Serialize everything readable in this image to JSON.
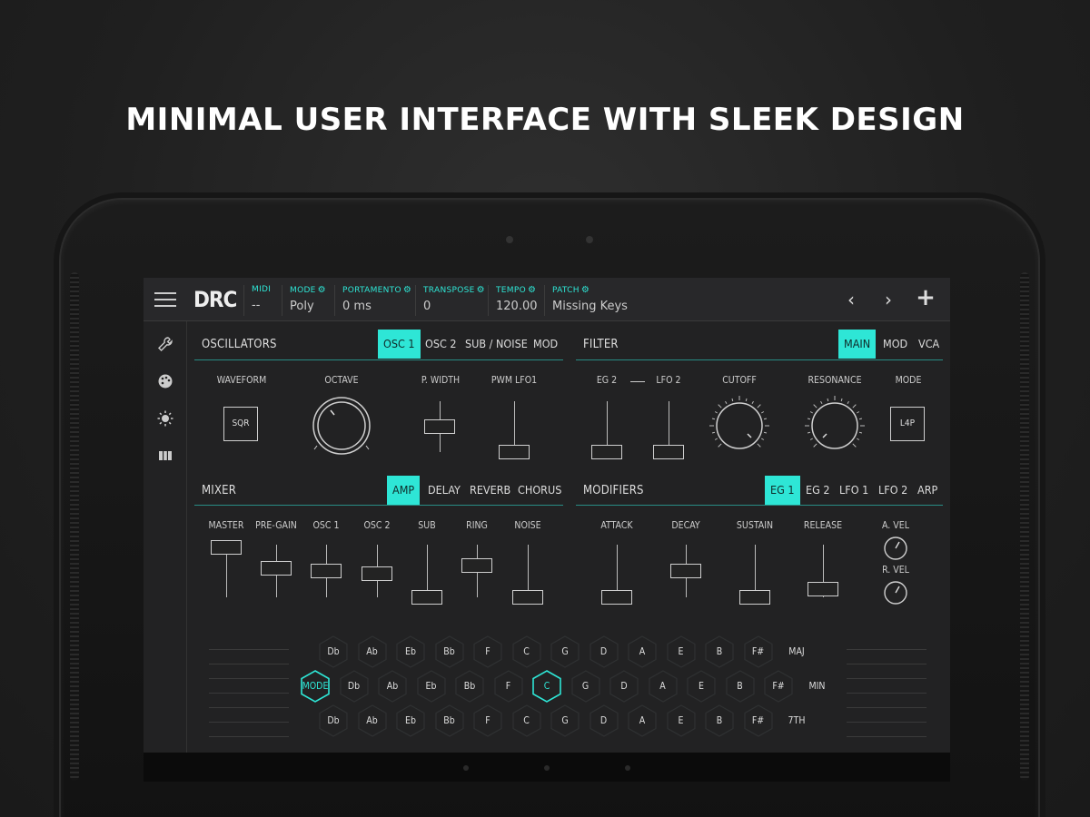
{
  "headline": "MINIMAL USER INTERFACE WITH SLEEK DESIGN",
  "accent_color": "#2ee6d6",
  "app": {
    "logo": "DRC",
    "fields": [
      {
        "label": "MIDI",
        "value": "--",
        "gear": false
      },
      {
        "label": "MODE",
        "value": "Poly",
        "gear": true
      },
      {
        "label": "PORTAMENTO",
        "value": "0 ms",
        "gear": true
      },
      {
        "label": "TRANSPOSE",
        "value": "0",
        "gear": true
      },
      {
        "label": "TEMPO",
        "value": "120.00",
        "gear": true
      },
      {
        "label": "PATCH",
        "value": "Missing Keys",
        "gear": true
      }
    ],
    "nav": {
      "prev": "‹",
      "next": "›",
      "add": "+"
    },
    "sidebar_icons": [
      "wrench-icon",
      "palette-icon",
      "brightness-icon",
      "film-icon"
    ]
  },
  "oscillators": {
    "title": "OSCILLATORS",
    "tabs": [
      "OSC 1",
      "OSC 2",
      "SUB / NOISE",
      "MOD"
    ],
    "active_tab": 0,
    "waveform_label": "WAVEFORM",
    "waveform_value": "SQR",
    "octave_label": "OCTAVE",
    "pwidth_label": "P. WIDTH",
    "pwm_label": "PWM LFO1"
  },
  "filter": {
    "title": "FILTER",
    "tabs": [
      "MAIN",
      "MOD",
      "VCA"
    ],
    "active_tab": 0,
    "eg2_label": "EG 2",
    "lfo2_label": "LFO 2",
    "cutoff_label": "CUTOFF",
    "resonance_label": "RESONANCE",
    "mode_label": "MODE",
    "mode_value": "L4P"
  },
  "mixer": {
    "title": "MIXER",
    "tabs": [
      "AMP",
      "DELAY",
      "REVERB",
      "CHORUS"
    ],
    "active_tab": 0,
    "channels": [
      {
        "label": "MASTER",
        "level": 0.95
      },
      {
        "label": "PRE-GAIN",
        "level": 0.55
      },
      {
        "label": "OSC 1",
        "level": 0.5
      },
      {
        "label": "OSC 2",
        "level": 0.45
      },
      {
        "label": "SUB",
        "level": 0.0
      },
      {
        "label": "RING",
        "level": 0.6
      },
      {
        "label": "NOISE",
        "level": 0.0
      }
    ]
  },
  "modifiers": {
    "title": "MODIFIERS",
    "tabs": [
      "EG 1",
      "EG 2",
      "LFO 1",
      "LFO 2",
      "ARP"
    ],
    "active_tab": 0,
    "sliders": [
      {
        "label": "ATTACK",
        "level": 0.0
      },
      {
        "label": "DECAY",
        "level": 0.5
      },
      {
        "label": "SUSTAIN",
        "level": 0.0
      },
      {
        "label": "RELEASE",
        "level": 0.15
      }
    ],
    "a_vel_label": "A. VEL",
    "r_vel_label": "R. VEL"
  },
  "keyboard": {
    "row1": [
      "Db",
      "Ab",
      "Eb",
      "Bb",
      "F",
      "C",
      "G",
      "D",
      "A",
      "E",
      "B",
      "F#",
      "MAJ"
    ],
    "row2": [
      "MODE",
      "Db",
      "Ab",
      "Eb",
      "Bb",
      "F",
      "C",
      "G",
      "D",
      "A",
      "E",
      "B",
      "F#",
      "MIN"
    ],
    "row3": [
      "Db",
      "Ab",
      "Eb",
      "Bb",
      "F",
      "C",
      "G",
      "D",
      "A",
      "E",
      "B",
      "F#",
      "7TH"
    ],
    "active_row2": [
      0,
      6
    ]
  }
}
